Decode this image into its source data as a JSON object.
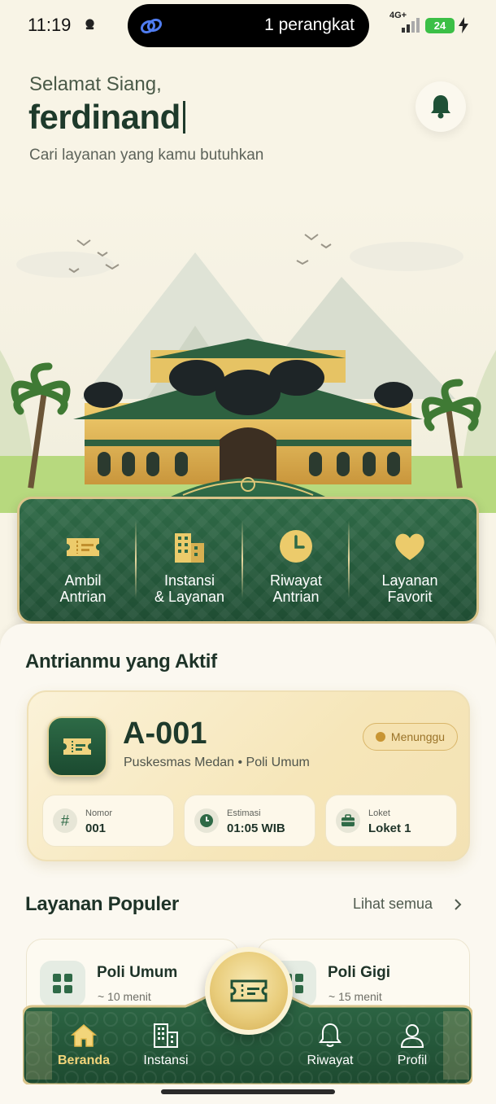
{
  "status_bar": {
    "time": "11:19",
    "island_text": "1 perangkat",
    "network": "4G+",
    "battery": "24"
  },
  "greeting": {
    "salutation": "Selamat Siang,",
    "name": "ferdinand",
    "subtitle": "Cari layanan yang kamu butuhkan"
  },
  "quick_menu": [
    {
      "label": "Ambil\nAntrian",
      "icon": "ticket-icon"
    },
    {
      "label": "Instansi\n& Layanan",
      "icon": "building-icon"
    },
    {
      "label": "Riwayat\nAntrian",
      "icon": "clock-icon"
    },
    {
      "label": "Layanan\nFavorit",
      "icon": "heart-icon"
    }
  ],
  "active_queue": {
    "section_title": "Antrianmu yang Aktif",
    "number": "A-001",
    "place": "Puskesmas Medan • Poli Umum",
    "status": "Menunggu",
    "info": [
      {
        "label": "Nomor",
        "value": "001",
        "icon": "hash-icon"
      },
      {
        "label": "Estimasi",
        "value": "01:05 WIB",
        "icon": "clock-icon"
      },
      {
        "label": "Loket",
        "value": "Loket 1",
        "icon": "briefcase-icon"
      }
    ]
  },
  "popular": {
    "section_title": "Layanan Populer",
    "see_all": "Lihat semua",
    "items": [
      {
        "title": "Poli Umum",
        "wait": "~ 10 menit",
        "icon": "grid-icon"
      },
      {
        "title": "Poli Gigi",
        "wait": "~ 15 menit",
        "icon": "grid-icon"
      }
    ]
  },
  "bottom_nav": [
    {
      "label": "Beranda",
      "icon": "home-icon",
      "active": true
    },
    {
      "label": "Instansi",
      "icon": "building-icon",
      "active": false
    },
    {
      "label": "Riwayat",
      "icon": "bell-icon",
      "active": false
    },
    {
      "label": "Profil",
      "icon": "user-icon",
      "active": false
    }
  ],
  "colors": {
    "primary_green": "#2f6a47",
    "gold": "#d9c48a",
    "background": "#f8f4e6"
  }
}
